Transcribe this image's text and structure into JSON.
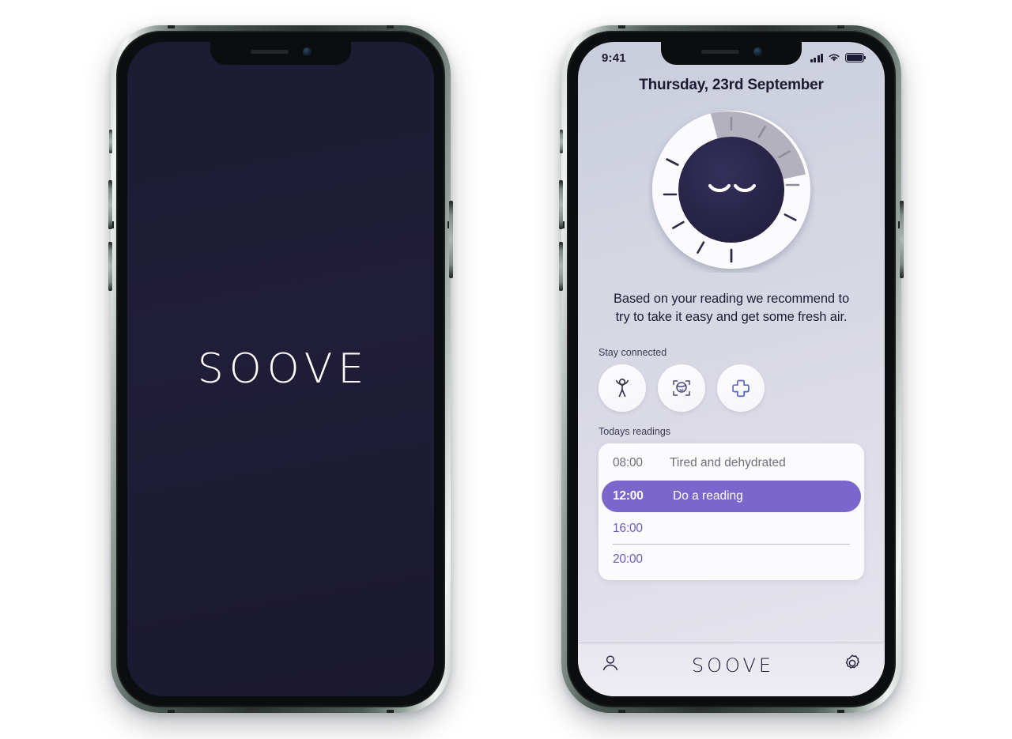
{
  "splash": {
    "logo": "SOOVE",
    "background_color": "#1d1b33"
  },
  "app": {
    "statusbar": {
      "time": "9:41",
      "signal_icon": "cellular-signal-icon",
      "wifi_icon": "wifi-icon",
      "battery_icon": "battery-icon"
    },
    "title": "Thursday, 23rd September",
    "gauge": {
      "name": "mood-gauge",
      "face": "sleeping-face",
      "track_color": "#fbfbfd",
      "progress_color": "#b3b1bd",
      "center_color": "#282445",
      "progress_percent": 35
    },
    "recommendation": "Based on your reading we recommend to try to take it easy and get some fresh air.",
    "stay_connected": {
      "label": "Stay connected",
      "items": [
        {
          "icon": "stretch-person-icon"
        },
        {
          "icon": "face-scan-icon"
        },
        {
          "icon": "plus-icon"
        }
      ]
    },
    "readings": {
      "label": "Todays readings",
      "rows": [
        {
          "time": "08:00",
          "desc": "Tired and dehydrated",
          "state": "done"
        },
        {
          "time": "12:00",
          "desc": "Do a reading",
          "state": "active"
        },
        {
          "time": "16:00",
          "desc": "",
          "state": "pending"
        },
        {
          "time": "20:00",
          "desc": "",
          "state": "pending"
        }
      ],
      "active_color": "#7b66cc"
    },
    "navbar": {
      "profile_icon": "person-icon",
      "logo": "SOOVE",
      "settings_icon": "gear-icon"
    }
  }
}
